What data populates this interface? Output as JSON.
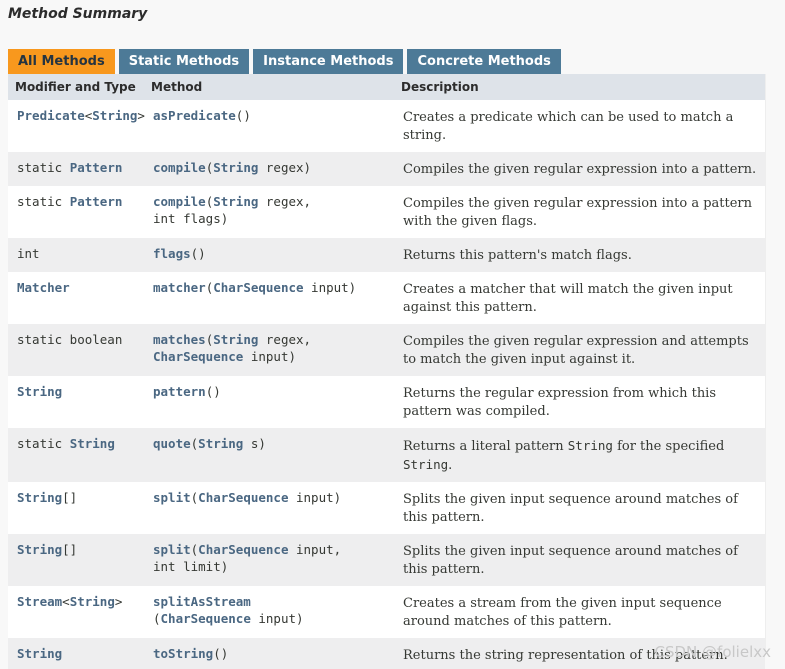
{
  "title": "Method Summary",
  "tabs": [
    "All Methods",
    "Static Methods",
    "Instance Methods",
    "Concrete Methods"
  ],
  "active_tab_index": 0,
  "columns": [
    "Modifier and Type",
    "Method",
    "Description"
  ],
  "rows": [
    {
      "type_mod": "",
      "type_main": "Predicate",
      "type_tail": "<",
      "type_link2": "String",
      "type_end": ">",
      "method_name": "asPredicate",
      "method_args": "()",
      "description": "Creates a predicate which can be used to match a string."
    },
    {
      "type_mod": "static ",
      "type_main": "Pattern",
      "type_tail": "",
      "type_link2": "",
      "type_end": "",
      "method_name": "compile",
      "method_args_pre": "(",
      "method_arg_type": "String",
      "method_args_post": " regex)",
      "description": "Compiles the given regular expression into a pattern."
    },
    {
      "type_mod": "static ",
      "type_main": "Pattern",
      "method_name": "compile",
      "method_args_pre": "(",
      "method_arg_type": "String",
      "method_args_post": " regex,",
      "method_args_line2": "int flags)",
      "description": "Compiles the given regular expression into a pattern with the given flags."
    },
    {
      "type_plain": "int",
      "method_name": "flags",
      "method_args": "()",
      "description": "Returns this pattern's match flags."
    },
    {
      "type_main": "Matcher",
      "method_name": "matcher",
      "method_args_pre": "(",
      "method_arg_type": "CharSequence",
      "method_args_post": " input)",
      "description": "Creates a matcher that will match the given input against this pattern."
    },
    {
      "type_plain": "static boolean",
      "method_name": "matches",
      "method_args_pre": "(",
      "method_arg_type": "String",
      "method_args_post": " regex,",
      "method_arg_type2": "CharSequence",
      "method_args_line2_post": " input)",
      "description": "Compiles the given regular expression and attempts to match the given input against it."
    },
    {
      "type_main": "String",
      "method_name": "pattern",
      "method_args": "()",
      "description": "Returns the regular expression from which this pattern was compiled."
    },
    {
      "type_mod": "static ",
      "type_main": "String",
      "method_name": "quote",
      "method_args_pre": "(",
      "method_arg_type": "String",
      "method_args_post": " s)",
      "description_pre": "Returns a literal pattern ",
      "description_code": "String",
      "description_mid": " for the specified",
      "description_code2": "String",
      "description_post": "."
    },
    {
      "type_main": "String",
      "type_tail": "[]",
      "method_name": "split",
      "method_args_pre": "(",
      "method_arg_type": "CharSequence",
      "method_args_post": " input)",
      "description": "Splits the given input sequence around matches of this pattern."
    },
    {
      "type_main": "String",
      "type_tail": "[]",
      "method_name": "split",
      "method_args_pre": "(",
      "method_arg_type": "CharSequence",
      "method_args_post": " input,",
      "method_args_line2": "int limit)",
      "description": "Splits the given input sequence around matches of this pattern."
    },
    {
      "type_main": "Stream",
      "type_tail": "<",
      "type_link2": "String",
      "type_end": ">",
      "method_name": "splitAsStream",
      "method_args_line2_pre": "(",
      "method_arg_type2": "CharSequence",
      "method_args_line2_post": " input)",
      "description": "Creates a stream from the given input sequence around matches of this pattern."
    },
    {
      "type_main": "String",
      "method_name": "toString",
      "method_args": "()",
      "description": "Returns the string representation of this pattern."
    }
  ],
  "watermark": "CSDN @folielxx"
}
